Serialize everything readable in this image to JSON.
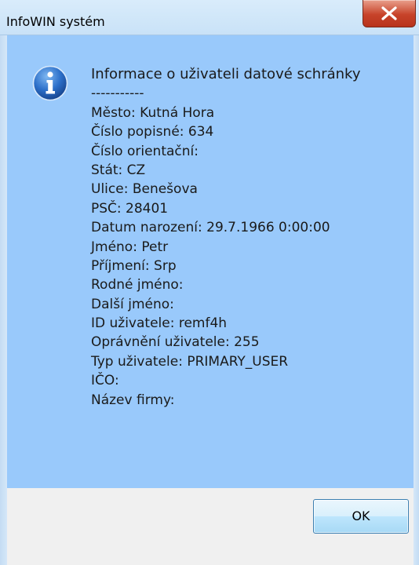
{
  "window": {
    "title": "InfoWIN systém"
  },
  "dialog": {
    "icon": "info-icon",
    "lines": [
      "Informace o uživateli datové schránky",
      "-----------",
      "Město: Kutná Hora",
      "Číslo popisné: 634",
      "Číslo orientační:",
      "Stát: CZ",
      "Ulice: Benešova",
      "PSČ: 28401",
      "Datum narození: 29.7.1966 0:00:00",
      "Jméno: Petr",
      "Příjmení: Srp",
      "Rodné jméno:",
      "Další jméno:",
      "ID uživatele: remf4h",
      "Oprávnění uživatele: 255",
      "Typ uživatele: PRIMARY_USER",
      "IČO:",
      "Název firmy:"
    ],
    "ok_label": "OK"
  },
  "colors": {
    "content_background": "#99c9fb",
    "footer_background": "#f0f0f0",
    "close_button": "#c7432a",
    "info_icon": "#1f5fb5"
  }
}
